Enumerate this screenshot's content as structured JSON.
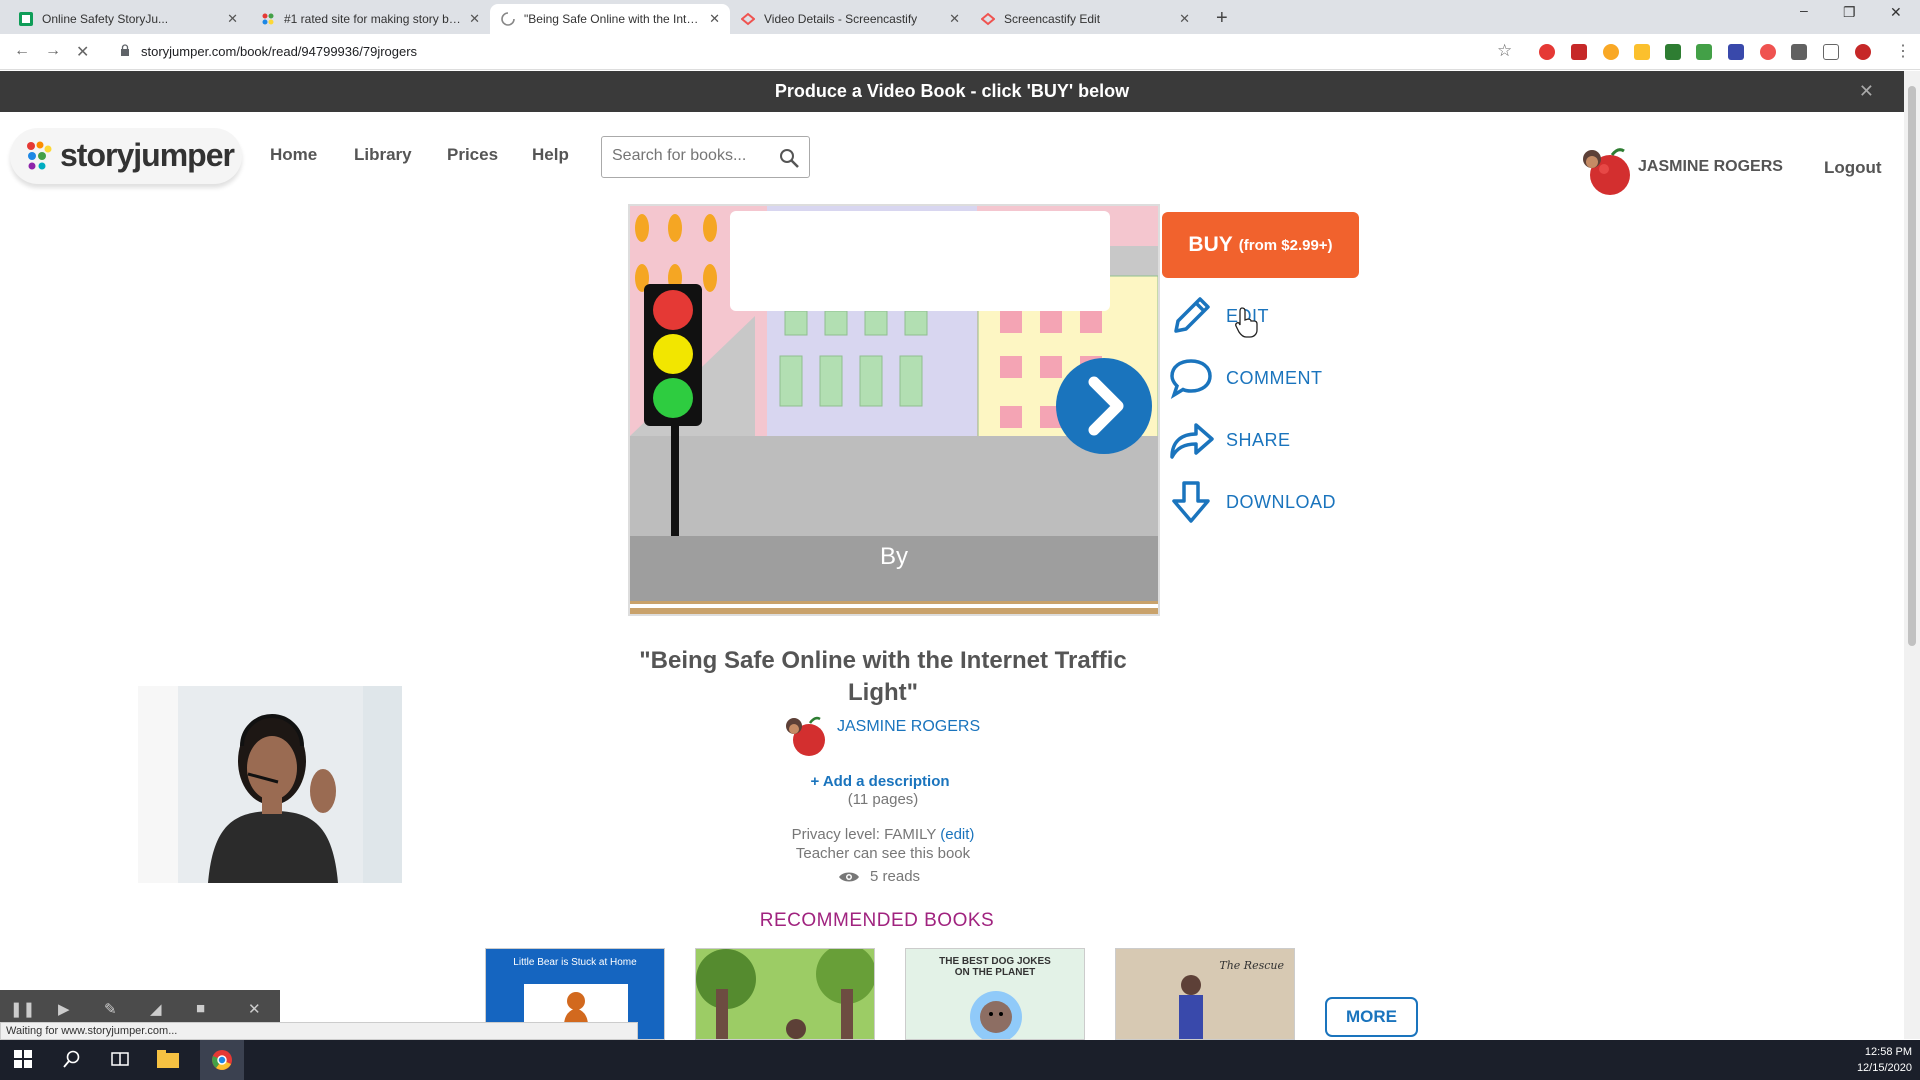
{
  "browser": {
    "tabs": [
      {
        "title": "Online Safety StoryJu...",
        "active": false
      },
      {
        "title": "#1 rated site for making story bo...",
        "active": false
      },
      {
        "title": "\"Being Safe Online with the Inter...",
        "active": true
      },
      {
        "title": "Video Details - Screencastify",
        "active": false
      },
      {
        "title": "Screencastify Edit",
        "active": false
      }
    ],
    "url": "storyjumper.com/book/read/94799936/79jrogers",
    "status_text": "Waiting for www.storyjumper.com..."
  },
  "banner": {
    "text": "Produce a Video Book - click 'BUY' below"
  },
  "header": {
    "logo_text": "storyjumper",
    "nav": [
      "Home",
      "Library",
      "Prices",
      "Help"
    ],
    "search_placeholder": "Search for books...",
    "user_name": "JASMINE ROGERS",
    "logout_label": "Logout"
  },
  "book": {
    "cover_by": "By",
    "title": "\"Being Safe Online with the Internet Traffic Light\"",
    "author": "JASMINE ROGERS",
    "add_description": "+ Add a description",
    "pages": "(11 pages)",
    "privacy_label": "Privacy level: FAMILY",
    "privacy_edit": "(edit)",
    "teacher_note": "Teacher can see this book",
    "reads": "5 reads"
  },
  "actions": {
    "buy_label": "BUY",
    "buy_price": "(from $2.99+)",
    "edit_label": "EDIT",
    "comment_label": "COMMENT",
    "share_label": "SHARE",
    "download_label": "DOWNLOAD"
  },
  "recommended": {
    "heading": "RECOMMENDED BOOKS",
    "books": [
      {
        "title": "Little Bear is Stuck at Home"
      },
      {
        "title": ""
      },
      {
        "title": "THE BEST DOG JOKES ON THE PLANET"
      },
      {
        "title": "The Rescue"
      }
    ],
    "more_label": "MORE"
  },
  "taskbar": {
    "time": "12:58 PM",
    "date": "12/15/2020"
  },
  "colors": {
    "brand_blue": "#1a74bd",
    "buy_orange": "#f1622d",
    "banner_bg": "#3a3a3a",
    "rec_heading": "#a0237f"
  }
}
